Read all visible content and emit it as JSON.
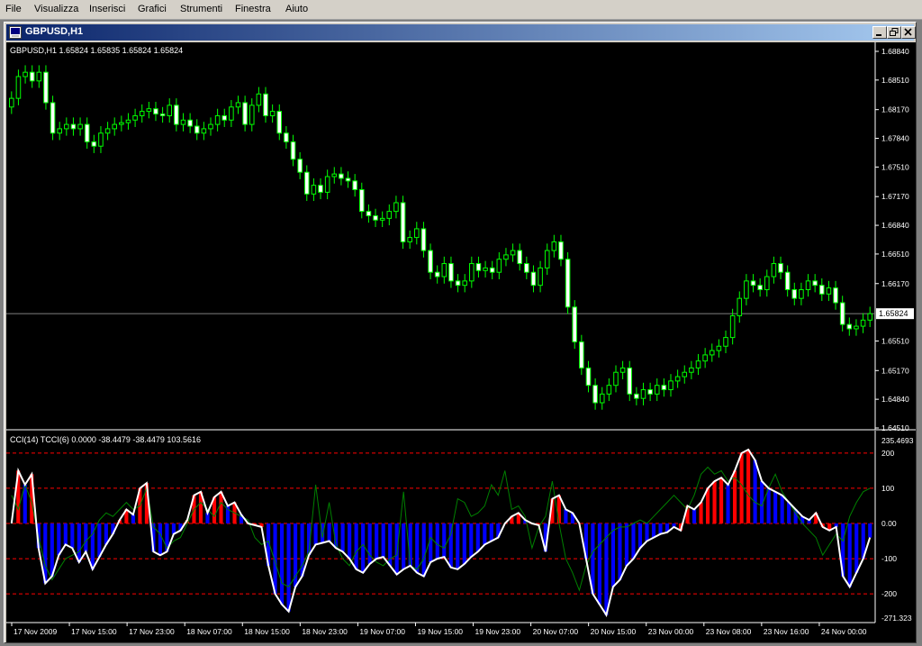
{
  "menu": {
    "file": "File",
    "view": "Visualizza",
    "insert": "Inserisci",
    "charts": "Grafici",
    "tools": "Strumenti",
    "window": "Finestra",
    "help": "Aiuto"
  },
  "window": {
    "title": "GBPUSD,H1",
    "icon": "chart-window-icon",
    "minimize_icon": "minimize-icon",
    "restore_icon": "restore-icon",
    "close_icon": "close-icon"
  },
  "colors": {
    "background": "#000000",
    "bull_candle": "#ffffff",
    "bear_candle": "#00ff00",
    "wick": "#00ff00",
    "cci_line": "#ffffff",
    "tcci_line": "#008000",
    "hist_up": "#ff0000",
    "hist_down": "#0000ff",
    "level_line": "#ff0000",
    "bid_line": "#808080"
  },
  "chart_data": [
    {
      "type": "candlestick",
      "symbol_label": "GBPUSD,H1  1.65824 1.65835 1.65824 1.65824",
      "ylim": [
        1.6451,
        1.6884
      ],
      "y_ticks": [
        "1.68840",
        "1.68510",
        "1.68170",
        "1.67840",
        "1.67510",
        "1.67170",
        "1.66840",
        "1.66510",
        "1.66170",
        "1.65510",
        "1.65170",
        "1.64840",
        "1.64510"
      ],
      "bid_label": "1.65824",
      "bid": 1.65824,
      "x_labels": [
        "17 Nov 2009",
        "17 Nov 15:00",
        "17 Nov 23:00",
        "18 Nov 07:00",
        "18 Nov 15:00",
        "18 Nov 23:00",
        "19 Nov 07:00",
        "19 Nov 15:00",
        "19 Nov 23:00",
        "20 Nov 07:00",
        "20 Nov 15:00",
        "23 Nov 00:00",
        "23 Nov 08:00",
        "23 Nov 16:00",
        "24 Nov 00:00"
      ],
      "closes": [
        1.683,
        1.6855,
        1.686,
        1.685,
        1.686,
        1.6825,
        1.679,
        1.6795,
        1.68,
        1.6795,
        1.68,
        1.678,
        1.6775,
        1.679,
        1.6795,
        1.68,
        1.6802,
        1.6805,
        1.681,
        1.6815,
        1.6818,
        1.6812,
        1.681,
        1.6822,
        1.68,
        1.6805,
        1.6798,
        1.679,
        1.6795,
        1.68,
        1.681,
        1.6805,
        1.682,
        1.6825,
        1.68,
        1.6822,
        1.6835,
        1.681,
        1.6815,
        1.679,
        1.678,
        1.676,
        1.6745,
        1.672,
        1.673,
        1.6722,
        1.674,
        1.6743,
        1.6738,
        1.6735,
        1.6725,
        1.67,
        1.6695,
        1.669,
        1.6692,
        1.67,
        1.671,
        1.6665,
        1.667,
        1.668,
        1.6655,
        1.663,
        1.6625,
        1.664,
        1.662,
        1.6615,
        1.662,
        1.664,
        1.6632,
        1.6635,
        1.663,
        1.6645,
        1.665,
        1.6655,
        1.664,
        1.663,
        1.6615,
        1.6635,
        1.6655,
        1.6665,
        1.6645,
        1.659,
        1.655,
        1.652,
        1.65,
        1.648,
        1.649,
        1.65,
        1.6515,
        1.652,
        1.649,
        1.6485,
        1.6495,
        1.649,
        1.65,
        1.6495,
        1.6505,
        1.651,
        1.6515,
        1.652,
        1.6528,
        1.6535,
        1.654,
        1.6545,
        1.6555,
        1.658,
        1.66,
        1.662,
        1.6615,
        1.661,
        1.6625,
        1.664,
        1.663,
        1.661,
        1.66,
        1.661,
        1.662,
        1.6615,
        1.6605,
        1.6612,
        1.6595,
        1.657,
        1.6565,
        1.6568,
        1.6575,
        1.65824
      ]
    },
    {
      "type": "line",
      "indicator_label": "CCI(14) TCCI(6) 0.0000 -38.4479 -38.4479 103.5616",
      "ylim": [
        -271.323,
        235.4693
      ],
      "y_ticks": [
        "235.4693",
        "200",
        "100",
        "0.00",
        "-100",
        "-200",
        "-271.323"
      ],
      "levels": [
        200,
        100,
        0,
        -100,
        -200
      ],
      "series": [
        {
          "values": [
            0,
            150,
            110,
            140,
            -70,
            -170,
            -150,
            -90,
            -60,
            -70,
            -110,
            -80,
            -130,
            -95,
            -60,
            -30,
            10,
            40,
            25,
            100,
            115,
            -80,
            -90,
            -80,
            -30,
            -20,
            10,
            80,
            90,
            30,
            75,
            90,
            50,
            60,
            25,
            0,
            -5,
            -10,
            -120,
            -200,
            -230,
            -250,
            -180,
            -150,
            -90,
            -60,
            -55,
            -50,
            -70,
            -80,
            -100,
            -130,
            -140,
            -115,
            -100,
            -95,
            -120,
            -145,
            -130,
            -120,
            -140,
            -150,
            -110,
            -100,
            -95,
            -125,
            -130,
            -115,
            -95,
            -80,
            -60,
            -50,
            -40,
            0,
            20,
            30,
            10,
            0,
            -5,
            -80,
            70,
            80,
            40,
            30,
            0,
            -100,
            -200,
            -230,
            -260,
            -180,
            -160,
            -120,
            -100,
            -70,
            -50,
            -40,
            -30,
            -25,
            -10,
            -20,
            50,
            40,
            60,
            100,
            120,
            130,
            110,
            150,
            200,
            210,
            180,
            120,
            100,
            90,
            80,
            60,
            40,
            20,
            10,
            30,
            -10,
            -20,
            -10,
            -150,
            -180,
            -140,
            -100,
            -40
          ]
        },
        {
          "values": [
            80,
            40,
            110,
            60,
            -40,
            -120,
            -160,
            -130,
            -100,
            -90,
            -80,
            -50,
            -30,
            10,
            30,
            20,
            40,
            60,
            40,
            50,
            100,
            -10,
            -30,
            -70,
            -50,
            -40,
            0,
            40,
            60,
            40,
            20,
            60,
            40,
            30,
            20,
            10,
            -40,
            -60,
            -50,
            -110,
            -170,
            -180,
            -150,
            -120,
            -80,
            110,
            -40,
            60,
            -60,
            -100,
            -120,
            -80,
            -60,
            -90,
            -110,
            -120,
            -100,
            -90,
            90,
            -120,
            -130,
            -100,
            -40,
            -60,
            -70,
            -30,
            70,
            60,
            20,
            30,
            50,
            110,
            80,
            150,
            40,
            50,
            20,
            -70,
            -10,
            20,
            120,
            0,
            -100,
            -140,
            -190,
            -120,
            -80,
            -60,
            -40,
            -20,
            -10,
            -10,
            0,
            10,
            0,
            20,
            40,
            60,
            80,
            60,
            40,
            80,
            140,
            160,
            140,
            150,
            120,
            130,
            110,
            80,
            60,
            50,
            100,
            140,
            90,
            60,
            30,
            0,
            -20,
            -40,
            -90,
            -60,
            -30,
            -50,
            20,
            60,
            90,
            100
          ]
        }
      ]
    }
  ]
}
